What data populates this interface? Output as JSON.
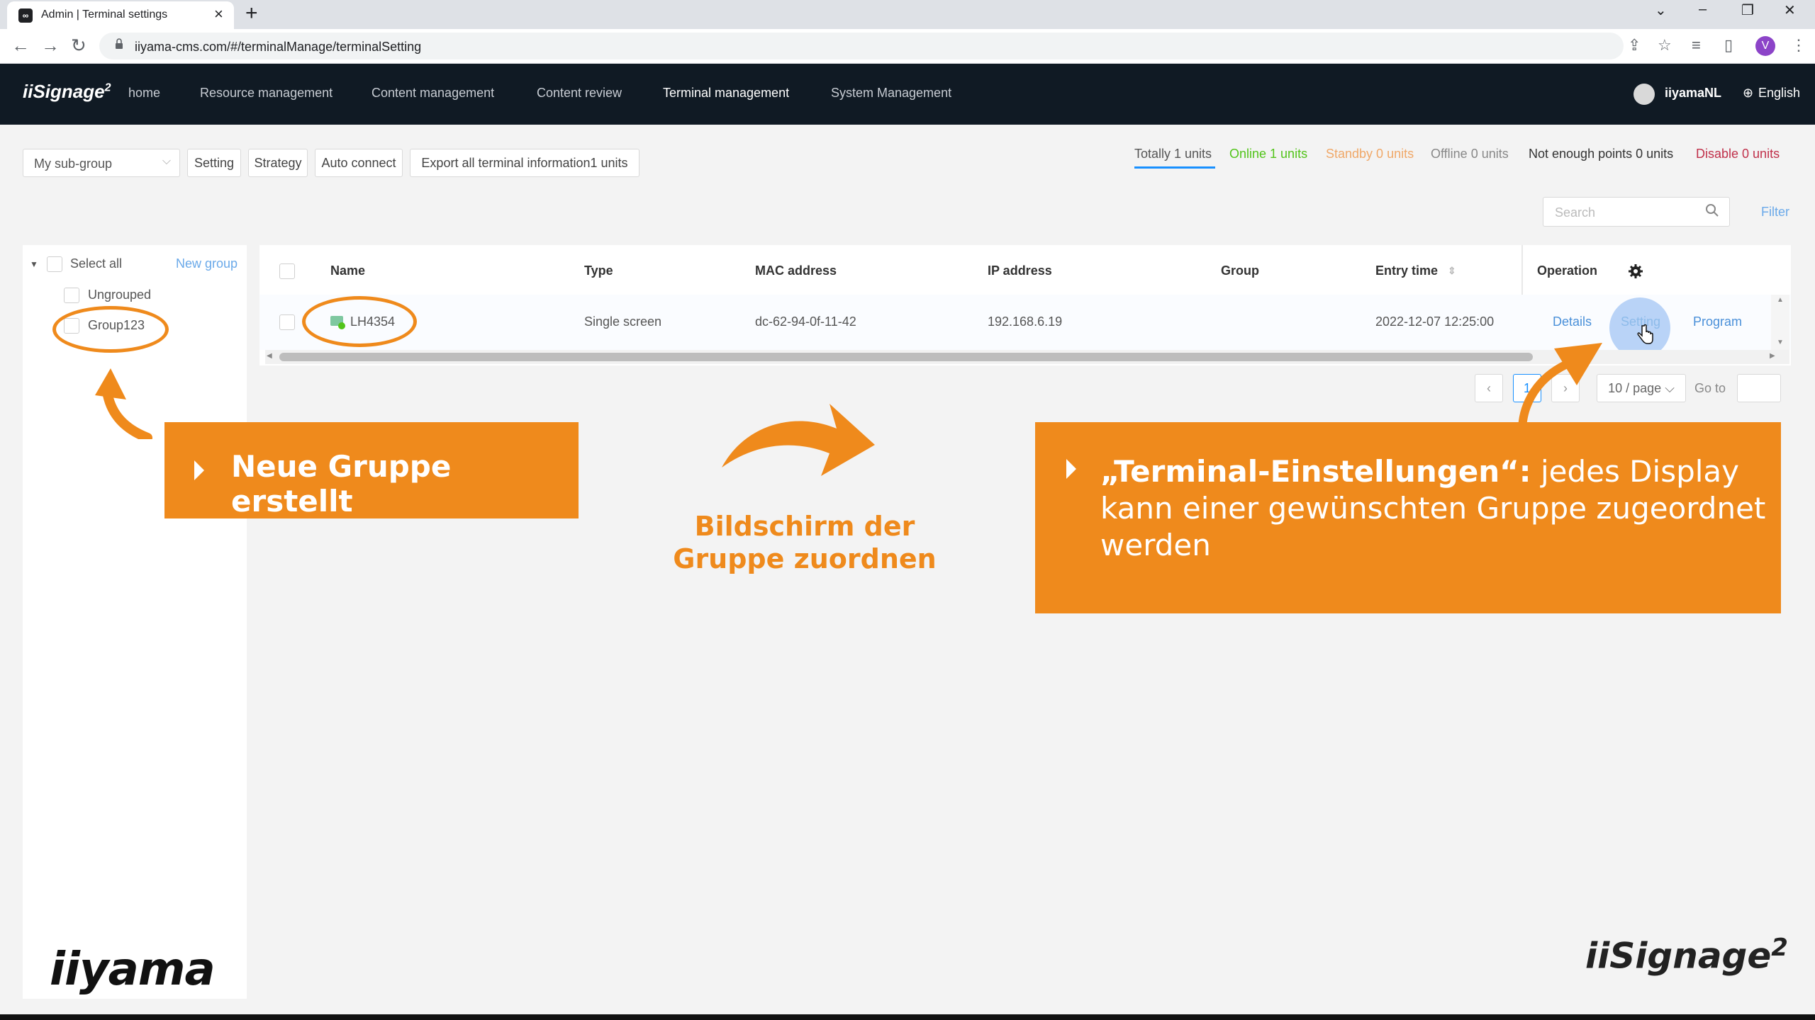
{
  "browser": {
    "tab_title": "Admin | Terminal settings",
    "url": "iiyama-cms.com/#/terminalManage/terminalSetting",
    "profile_initial": "V"
  },
  "app": {
    "logo": "iiSignage",
    "logo_sup": "2",
    "nav": [
      "home",
      "Resource management",
      "Content management",
      "Content review",
      "Terminal management",
      "System Management"
    ],
    "active_nav": "Terminal management",
    "user": "iiyamaNL",
    "language": "English"
  },
  "actions": {
    "subgroup_value": "My sub-group",
    "setting": "Setting",
    "strategy": "Strategy",
    "auto_connect": "Auto connect",
    "export": "Export all terminal information1 units"
  },
  "stats": {
    "total": "Totally 1 units",
    "online": "Online 1 units",
    "standby": "Standby 0 units",
    "offline": "Offline 0 units",
    "not_enough": "Not enough points 0 units",
    "disable": "Disable 0 units",
    "colors": {
      "online": "#52c41a",
      "standby": "#f0a868",
      "disable": "#c0304a"
    }
  },
  "search": {
    "placeholder": "Search",
    "filter": "Filter"
  },
  "tree": {
    "select_all": "Select all",
    "new_group": "New group",
    "groups": [
      "Ungrouped",
      "Group123"
    ]
  },
  "table": {
    "headers": {
      "name": "Name",
      "type": "Type",
      "mac": "MAC address",
      "ip": "IP address",
      "group": "Group",
      "entry_time": "Entry time",
      "operation": "Operation"
    },
    "rows": [
      {
        "name": "LH4354",
        "type": "Single screen",
        "mac": "dc-62-94-0f-11-42",
        "ip": "192.168.6.19",
        "group": "",
        "entry_time": "2022-12-07 12:25:00",
        "ops": {
          "details": "Details",
          "setting": "Setting",
          "program": "Program"
        }
      }
    ]
  },
  "pagination": {
    "current_page": "1",
    "page_size": "10 / page",
    "goto_label": "Go to"
  },
  "overlays": {
    "callout_left": "Neue Gruppe erstellt",
    "center_line1": "Bildschirm der",
    "center_line2": "Gruppe zuordnen",
    "callout_right_bold": "„Terminal-Einstellungen“:",
    "callout_right_rest": " jedes Display kann einer gewünschten Gruppe zugeordnet werden",
    "accent_color": "#ef8a1c"
  },
  "branding": {
    "iiyama": "iiyama",
    "iisignage": "iiSignage",
    "iisignage_sup": "2"
  }
}
